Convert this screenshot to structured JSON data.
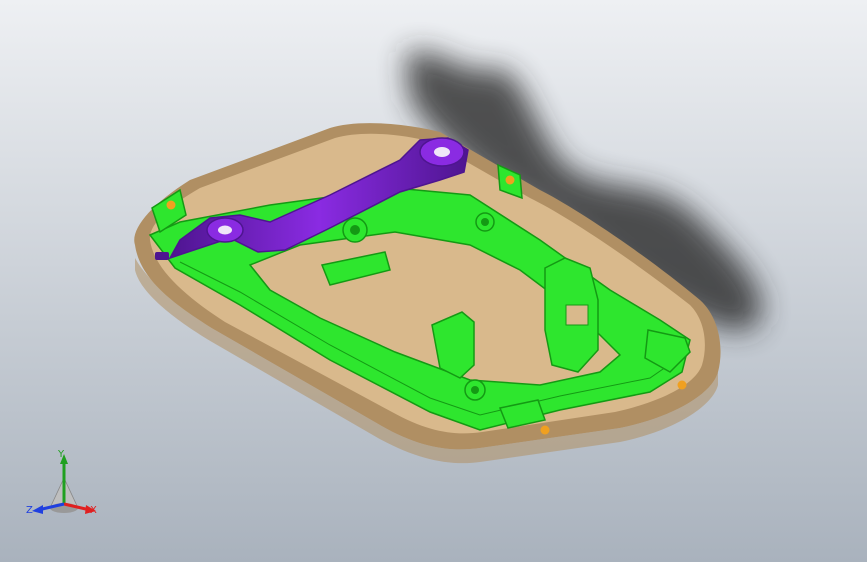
{
  "colors": {
    "background_top": "#eef0f3",
    "background_bottom": "#a9b2bd",
    "tray_fill": "#d9b98c",
    "tray_shade": "#b08f63",
    "green_part": "#2ee62e",
    "green_dark": "#149a14",
    "purple_part": "#8a2be2",
    "purple_dark": "#4e1590",
    "pin_color": "#f0a020",
    "shadow": "#2a2a2a"
  },
  "triad": {
    "x_label": "X",
    "y_label": "Y",
    "z_label": "Z",
    "x_color": "#e02020",
    "y_color": "#20a020",
    "z_color": "#2040e0"
  }
}
